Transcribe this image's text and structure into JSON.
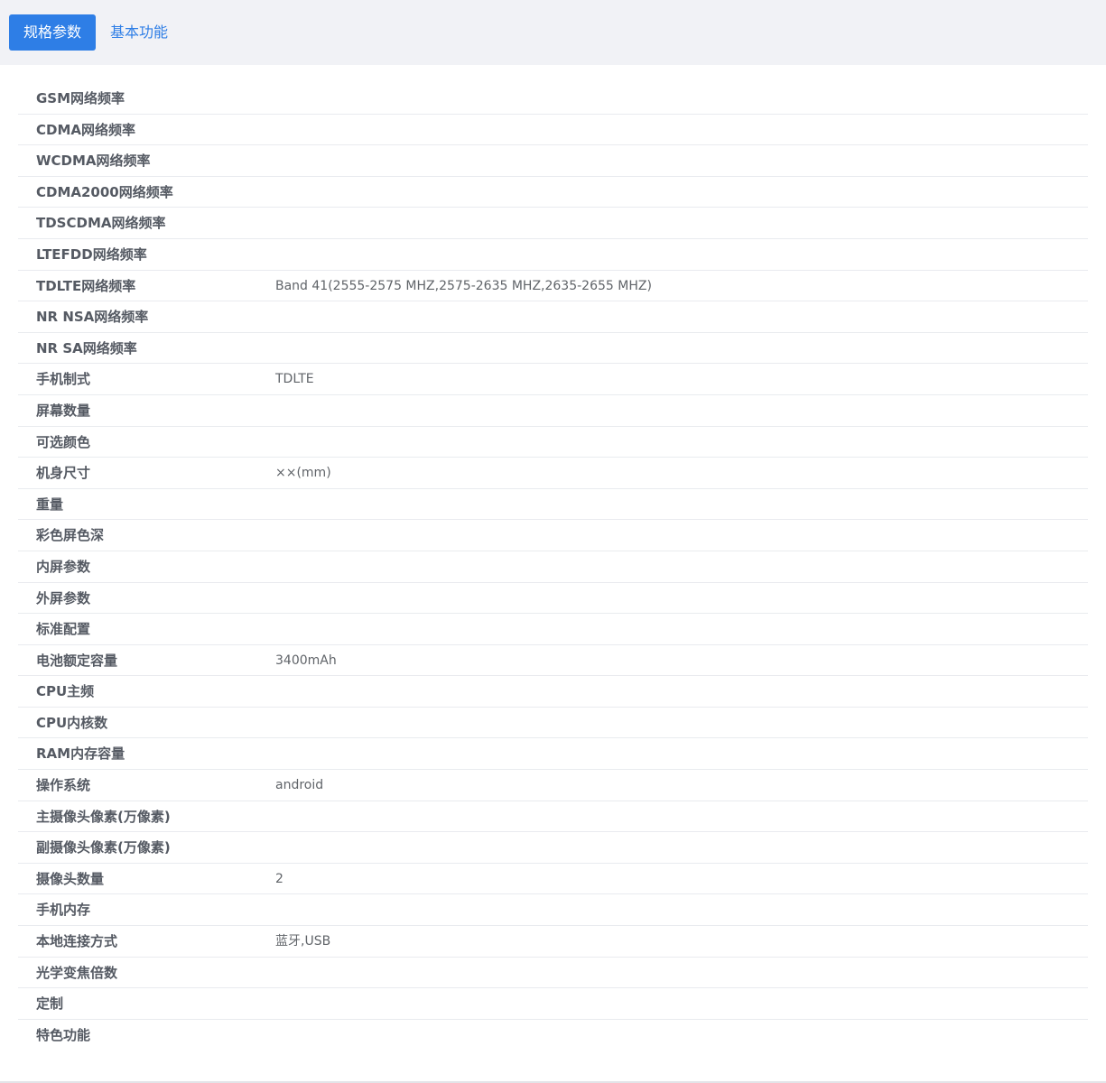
{
  "tabs": [
    {
      "label": "规格参数",
      "active": true
    },
    {
      "label": "基本功能",
      "active": false
    }
  ],
  "specs": [
    {
      "label": "GSM网络频率",
      "value": ""
    },
    {
      "label": "CDMA网络频率",
      "value": ""
    },
    {
      "label": "WCDMA网络频率",
      "value": ""
    },
    {
      "label": "CDMA2000网络频率",
      "value": ""
    },
    {
      "label": "TDSCDMA网络频率",
      "value": ""
    },
    {
      "label": "LTEFDD网络频率",
      "value": ""
    },
    {
      "label": "TDLTE网络频率",
      "value": "Band 41(2555-2575 MHZ,2575-2635 MHZ,2635-2655 MHZ)"
    },
    {
      "label": "NR NSA网络频率",
      "value": ""
    },
    {
      "label": "NR SA网络频率",
      "value": ""
    },
    {
      "label": "手机制式",
      "value": "TDLTE"
    },
    {
      "label": "屏幕数量",
      "value": ""
    },
    {
      "label": "可选颜色",
      "value": ""
    },
    {
      "label": "机身尺寸",
      "value": "××(mm)"
    },
    {
      "label": "重量",
      "value": ""
    },
    {
      "label": "彩色屏色深",
      "value": ""
    },
    {
      "label": "内屏参数",
      "value": ""
    },
    {
      "label": "外屏参数",
      "value": ""
    },
    {
      "label": "标准配置",
      "value": ""
    },
    {
      "label": "电池额定容量",
      "value": "3400mAh"
    },
    {
      "label": "CPU主频",
      "value": ""
    },
    {
      "label": "CPU内核数",
      "value": ""
    },
    {
      "label": "RAM内存容量",
      "value": ""
    },
    {
      "label": "操作系统",
      "value": "android"
    },
    {
      "label": "主摄像头像素(万像素)",
      "value": ""
    },
    {
      "label": "副摄像头像素(万像素)",
      "value": ""
    },
    {
      "label": "摄像头数量",
      "value": "2"
    },
    {
      "label": "手机内存",
      "value": ""
    },
    {
      "label": "本地连接方式",
      "value": "蓝牙,USB"
    },
    {
      "label": "光学变焦倍数",
      "value": ""
    },
    {
      "label": "定制",
      "value": ""
    },
    {
      "label": "特色功能",
      "value": ""
    }
  ],
  "colors": {
    "accent": "#2e7ee6",
    "tab_bar_bg": "#f1f2f6",
    "label_text": "#555a63",
    "value_text": "#606469",
    "row_divider": "#e9ebef"
  }
}
